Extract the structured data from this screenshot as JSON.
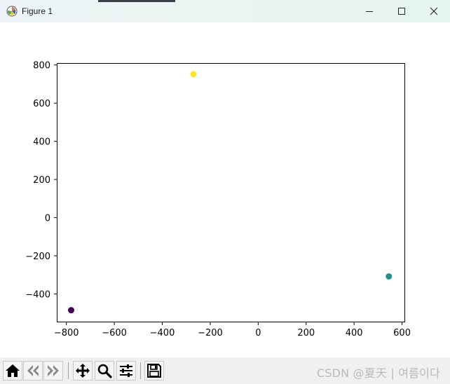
{
  "window": {
    "title": "Figure 1",
    "controls": [
      "minimize",
      "maximize",
      "close"
    ]
  },
  "toolbar": {
    "buttons": [
      {
        "name": "home",
        "icon": "home-icon"
      },
      {
        "name": "back",
        "icon": "back-arrow-icon"
      },
      {
        "name": "forward",
        "icon": "forward-arrow-icon"
      },
      {
        "name": "pan",
        "icon": "move-icon"
      },
      {
        "name": "zoom",
        "icon": "magnifier-icon"
      },
      {
        "name": "configure-subplots",
        "icon": "sliders-icon"
      },
      {
        "name": "save",
        "icon": "floppy-disk-icon"
      }
    ],
    "watermark": "CSDN @夏天 | 여름이다"
  },
  "chart_data": {
    "type": "scatter",
    "title": "",
    "xlabel": "",
    "ylabel": "",
    "xlim": [
      -840,
      610
    ],
    "ylim": [
      -545,
      810
    ],
    "xticks": [
      -800,
      -600,
      -400,
      -200,
      0,
      200,
      400,
      600
    ],
    "xtick_labels": [
      "−800",
      "−600",
      "−400",
      "−200",
      "0",
      "200",
      "400",
      "600"
    ],
    "yticks": [
      -400,
      -200,
      0,
      200,
      400,
      600,
      800
    ],
    "ytick_labels": [
      "−400",
      "−200",
      "0",
      "200",
      "400",
      "600",
      "800"
    ],
    "grid": false,
    "points": [
      {
        "x": -780,
        "y": -485,
        "color": "#440154"
      },
      {
        "x": 545,
        "y": -308,
        "color": "#21918c"
      },
      {
        "x": -270,
        "y": 752,
        "color": "#fde725"
      }
    ]
  }
}
